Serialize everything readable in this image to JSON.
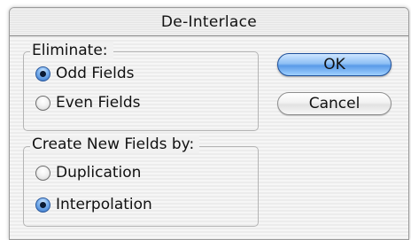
{
  "dialog": {
    "title": "De-Interlace"
  },
  "eliminate": {
    "label": "Eliminate:",
    "options": [
      {
        "label": "Odd Fields",
        "selected": true
      },
      {
        "label": "Even Fields",
        "selected": false
      }
    ]
  },
  "create_fields": {
    "label": "Create New Fields by:",
    "options": [
      {
        "label": "Duplication",
        "selected": false
      },
      {
        "label": "Interpolation",
        "selected": true
      }
    ]
  },
  "buttons": {
    "ok_label": "OK",
    "cancel_label": "Cancel"
  },
  "colors": {
    "default_button": "#5a9ae8",
    "radio_selected": "#2f6fc6"
  }
}
